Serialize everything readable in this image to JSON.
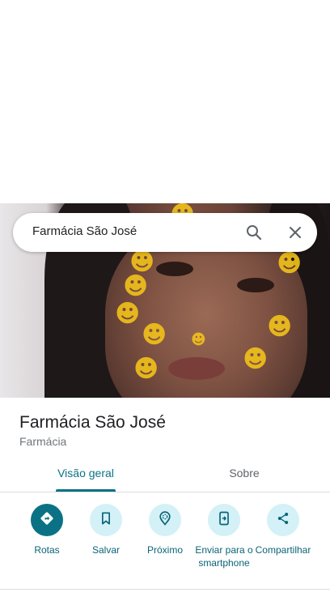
{
  "search": {
    "query": "Farmácia São José"
  },
  "place": {
    "name": "Farmácia São José",
    "category": "Farmácia"
  },
  "tabs": [
    {
      "label": "Visão geral",
      "active": true
    },
    {
      "label": "Sobre",
      "active": false
    }
  ],
  "actions": [
    {
      "label": "Rotas",
      "icon": "directions-icon"
    },
    {
      "label": "Salvar",
      "icon": "bookmark-icon"
    },
    {
      "label": "Próximo",
      "icon": "nearby-icon"
    },
    {
      "label": "Enviar para o smartphone",
      "icon": "send-to-phone-icon"
    },
    {
      "label": "Compartilhar",
      "icon": "share-icon"
    }
  ],
  "colors": {
    "accent": "#0b7285",
    "action_bg": "#d3f1f7",
    "text_primary": "#202124",
    "text_secondary": "#70757a"
  }
}
